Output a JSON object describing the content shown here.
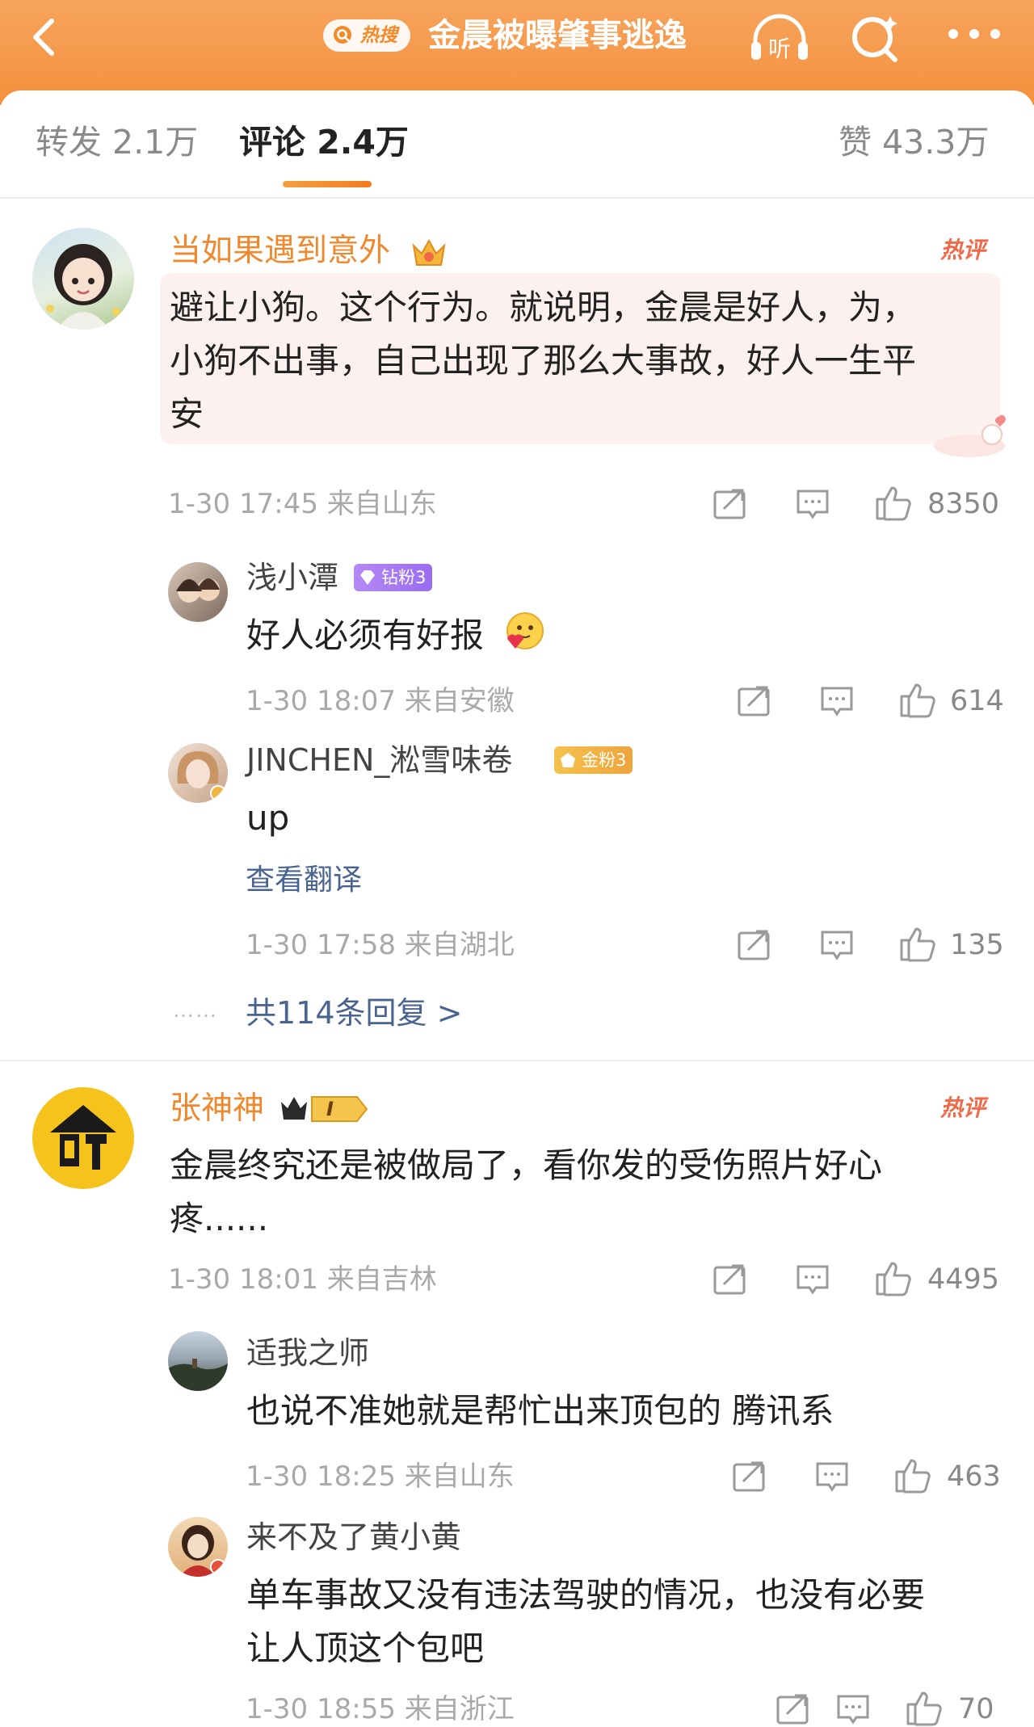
{
  "header": {
    "hot_tag": "热搜",
    "topic_title": "金晨被曝肇事逃逸",
    "listen_label": "听"
  },
  "tabs": {
    "repost": "转发 2.1万",
    "comments": "评论 2.4万",
    "likes": "赞 43.3万"
  },
  "comments": [
    {
      "username": "当如果遇到意外",
      "hot_badge": "热评",
      "text_line1": "避让小狗。这个行为。就说明，金晨是好人，为，",
      "text_line2": "小狗不出事，自己出现了那么大事故，好人一生平",
      "text_line3": "安",
      "meta": "1-30 17:45  来自山东",
      "likes": "8350",
      "replies": [
        {
          "username": "浅小潭",
          "badge": "钻粉3",
          "text": "好人必须有好报",
          "meta": "1-30 18:07  来自安徽",
          "likes": "614"
        },
        {
          "username": "JINCHEN_淞雪味卷",
          "badge": "金粉3",
          "text": "up",
          "translate": "查看翻译",
          "meta": "1-30 17:58  来自湖北",
          "likes": "135"
        }
      ],
      "more_replies": "共114条回复 >"
    },
    {
      "username": "张神神",
      "level_badge": "I",
      "hot_badge": "热评",
      "text_line1": "金晨终究还是被做局了，看你发的受伤照片好心",
      "text_line2": "疼......",
      "meta": "1-30 18:01  来自吉林",
      "likes": "4495",
      "replies": [
        {
          "username": "适我之师",
          "text": "也说不准她就是帮忙出来顶包的 腾讯系",
          "meta": "1-30 18:25  来自山东",
          "likes": "463"
        },
        {
          "username": "来不及了黄小黄",
          "text_line1": "单车事故又没有违法驾驶的情况，也没有必要",
          "text_line2": "让人顶这个包吧",
          "meta": "1-30 18:55  来自浙江",
          "likes": "70"
        }
      ]
    }
  ],
  "colors": {
    "header_orange": "#f4913d",
    "username_orange": "#f0882e",
    "hot_red": "#f06a4a",
    "link_blue": "#4a6491",
    "diamond_purple": "#b07cf0",
    "gold": "#f2b544"
  }
}
